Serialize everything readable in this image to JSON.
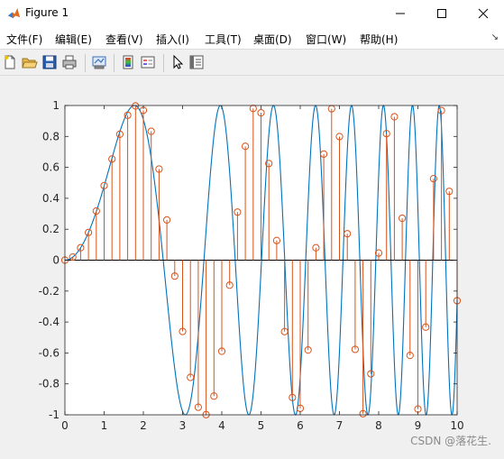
{
  "window": {
    "title": "Figure 1",
    "controls": [
      "minimize",
      "maximize",
      "close"
    ]
  },
  "menu": [
    {
      "label": "文件(F)"
    },
    {
      "label": "编辑(E)"
    },
    {
      "label": "查看(V)"
    },
    {
      "label": "插入(I)"
    },
    {
      "label": "工具(T)"
    },
    {
      "label": "桌面(D)"
    },
    {
      "label": "窗口(W)"
    },
    {
      "label": "帮助(H)"
    }
  ],
  "toolbar": {
    "icons": [
      "new-file-icon",
      "open-folder-icon",
      "save-icon",
      "print-icon",
      "link-plot-icon",
      "colorbar-icon",
      "legend-icon",
      "edit-plot-cursor-icon",
      "property-inspector-icon"
    ]
  },
  "watermark": "CSDN @落花生.",
  "colors": {
    "curve": "#0072BD",
    "stem": "#D95319",
    "axes_bg": "#ffffff",
    "figure_bg": "#f0f0f0"
  },
  "chart_data": {
    "type": "line+stem",
    "title": "",
    "xlabel": "",
    "ylabel": "",
    "xlim": [
      0,
      10
    ],
    "ylim": [
      -1,
      1
    ],
    "xticks": [
      "0",
      "1",
      "2",
      "3",
      "4",
      "5",
      "6",
      "7",
      "8",
      "9",
      "10"
    ],
    "yticks": [
      "-1",
      "-0.8",
      "-0.6",
      "-0.4",
      "-0.2",
      "0",
      "0.2",
      "0.4",
      "0.6",
      "0.8",
      "1"
    ],
    "grid": false,
    "series": [
      {
        "type": "line",
        "function": "sin(0.5*x^2)",
        "x_range": [
          0,
          10
        ]
      },
      {
        "type": "stem",
        "marker": "circle",
        "x_step": 0.2,
        "x_range": [
          0,
          10
        ],
        "values": [
          0,
          0.02,
          0.08,
          0.179,
          0.318,
          0.482,
          0.654,
          0.814,
          0.937,
          0.997,
          0.969,
          0.833,
          0.589,
          0.26,
          -0.103,
          -0.461,
          -0.758,
          -0.951,
          -0.999,
          -0.879,
          -0.589,
          -0.162,
          0.311,
          0.736,
          0.981,
          0.953,
          0.625,
          0.127,
          -0.462,
          -0.888,
          -0.958,
          -0.581,
          0.08,
          0.686,
          0.979,
          0.799,
          0.171,
          -0.577,
          -0.993,
          -0.735,
          0.046,
          0.818,
          0.927,
          0.271,
          -0.616,
          -0.963,
          -0.433,
          0.527,
          0.967,
          0.445,
          -0.262
        ]
      }
    ]
  }
}
